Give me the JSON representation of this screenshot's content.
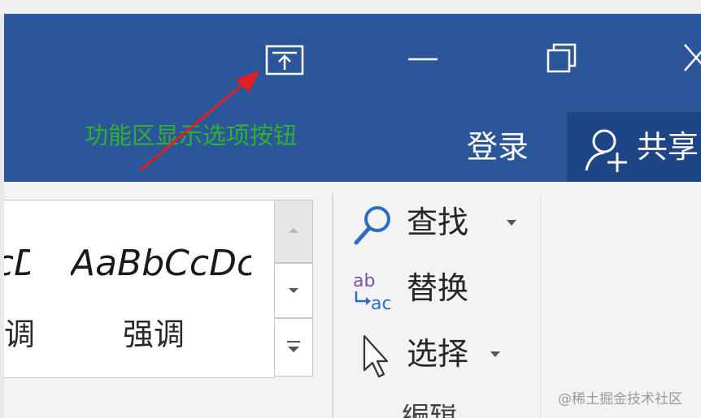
{
  "annotation": {
    "text": "功能区显示选项按钮",
    "color": "#30b030",
    "arrow_color": "#e02020"
  },
  "title_bar": {
    "color": "#2b579a",
    "login": "登录",
    "share": "共享"
  },
  "styles_gallery": {
    "items": [
      {
        "sample": "AaBbCcDc",
        "name": "强调"
      },
      {
        "sample": "AaBbCcDc",
        "name": "强调"
      }
    ]
  },
  "editing": {
    "find": "查找",
    "replace": "替换",
    "select": "选择",
    "replace_icon_top": "ab",
    "replace_icon_bottom": "ac",
    "group_label": "编辑"
  },
  "watermark": "@稀土掘金技术社区",
  "icons": {
    "ribbon_display": "ribbon-display-options-icon",
    "minimize": "minimize-icon",
    "restore": "restore-icon",
    "close": "close-icon",
    "share": "add-person-icon",
    "find": "magnifier-icon",
    "replace": "replace-ab-ac-icon",
    "select": "cursor-arrow-icon"
  }
}
